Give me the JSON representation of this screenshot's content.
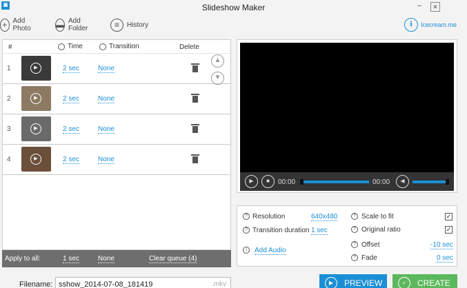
{
  "window": {
    "title": "Slideshow Maker",
    "app_icon_text": "▣",
    "minimize_icon": "−",
    "close_icon": "✕"
  },
  "toolbar": {
    "add_photo": "Add Photo",
    "add_folder": "Add Folder",
    "history": "History",
    "brand": "Icecream.me"
  },
  "list": {
    "headers": {
      "num": "#",
      "time": "Time",
      "transition": "Transition",
      "delete": "Delete"
    },
    "rows": [
      {
        "num": "1",
        "time": "2 sec",
        "transition": "None",
        "thumb_color": "#3a3a3a"
      },
      {
        "num": "2",
        "time": "2 sec",
        "transition": "None",
        "thumb_color": "#8c7a62"
      },
      {
        "num": "3",
        "time": "2 sec",
        "transition": "None",
        "thumb_color": "#6a6a6a"
      },
      {
        "num": "4",
        "time": "2 sec",
        "transition": "None",
        "thumb_color": "#6b4f3a"
      }
    ]
  },
  "apply_all": {
    "label": "Apply to all:",
    "time": "1 sec",
    "transition": "None",
    "clear": "Clear queue (4)"
  },
  "filename": {
    "label": "Filename:",
    "value": "sshow_2014-07-08_181419",
    "extension": ".mkv"
  },
  "player": {
    "current": "00:00",
    "total": "00:00"
  },
  "settings": {
    "resolution_label": "Resolution",
    "resolution_value": "640x480",
    "transition_duration_label": "Transition duration",
    "transition_duration_value": "1 sec",
    "add_audio": "Add Audio",
    "scale_to_fit_label": "Scale to fit",
    "scale_to_fit_checked": true,
    "original_ratio_label": "Original ratio",
    "original_ratio_checked": true,
    "offset_label": "Offset",
    "offset_value": "-10 sec",
    "fade_label": "Fade",
    "fade_value": "0 sec"
  },
  "buttons": {
    "preview": "PREVIEW",
    "create": "CREATE"
  },
  "colors": {
    "accent": "#1b8fd6",
    "create": "#5cb85c"
  }
}
